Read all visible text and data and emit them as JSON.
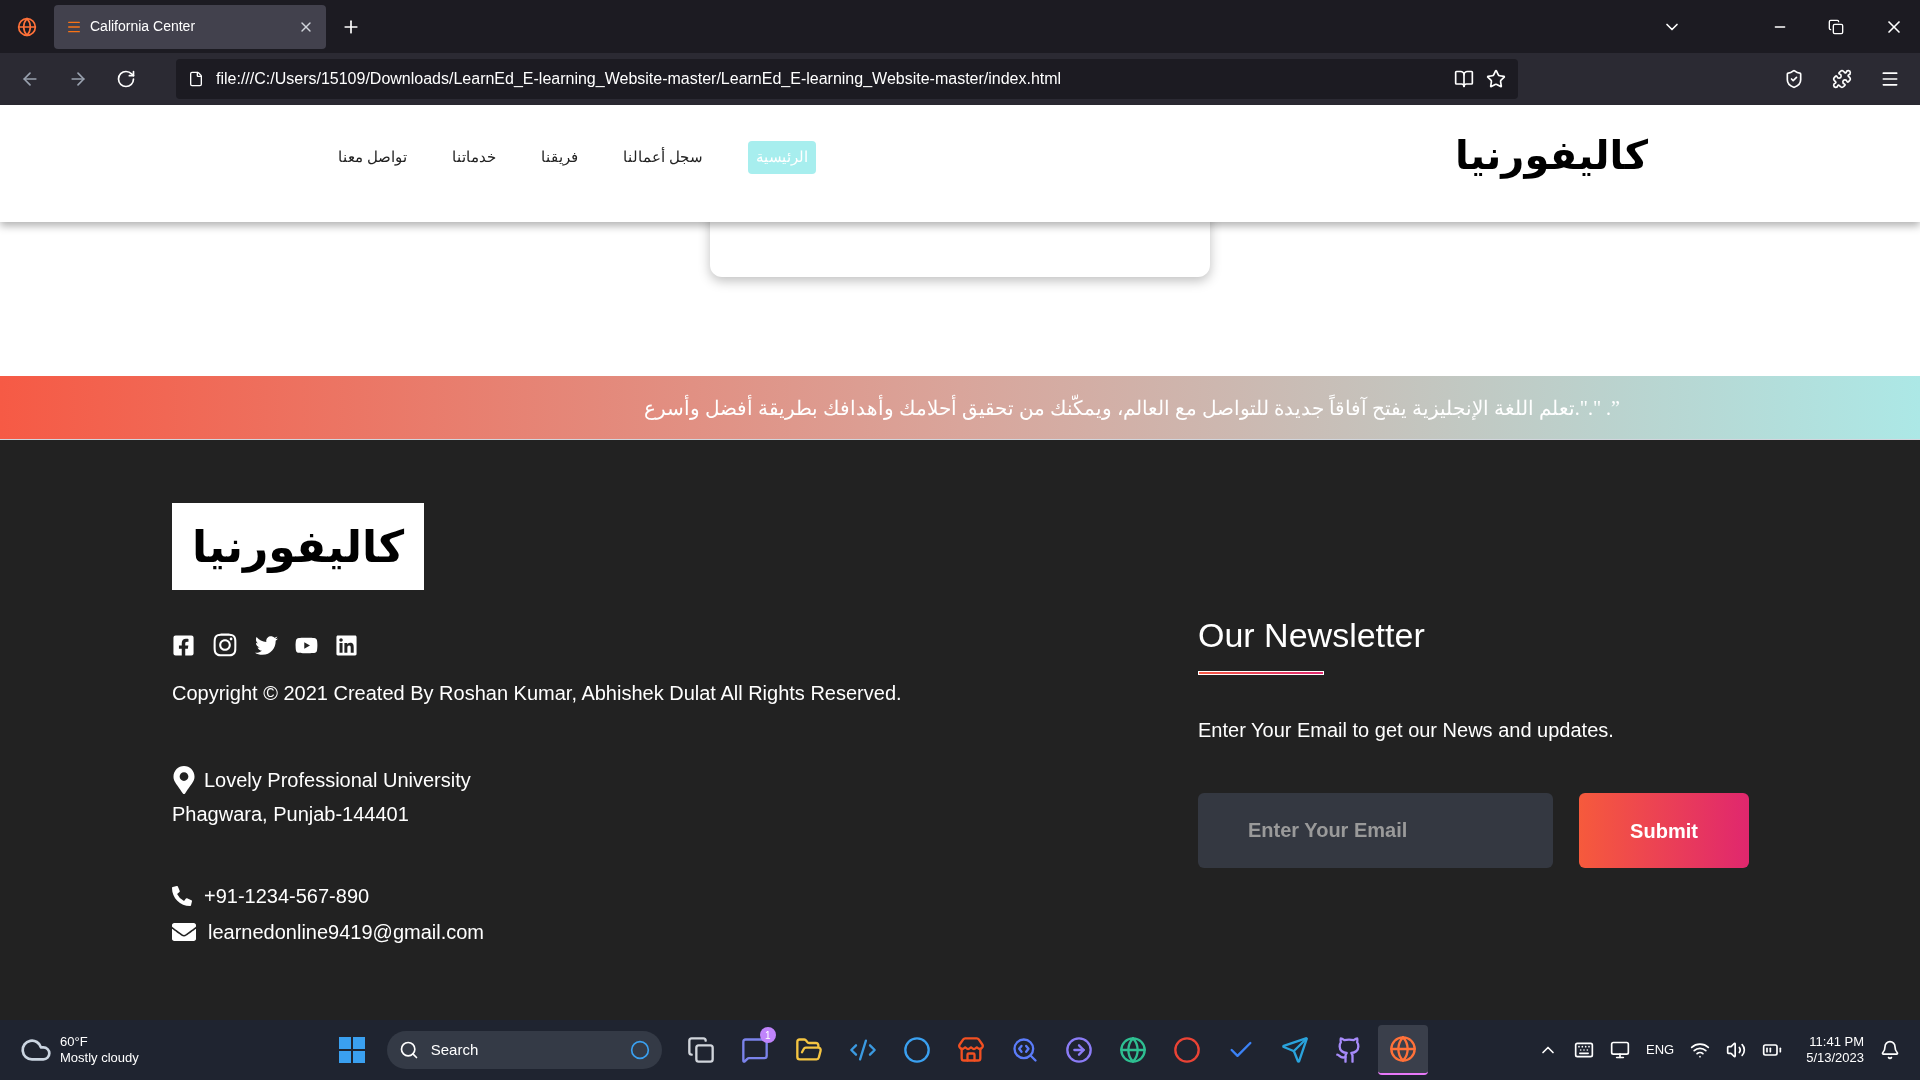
{
  "browser": {
    "tab_title": "California Center",
    "url": "file:///C:/Users/15109/Downloads/LearnEd_E-learning_Website-master/LearnEd_E-learning_Website-master/index.html"
  },
  "header": {
    "logo": "كاليفورنيا",
    "nav": [
      {
        "label": "الرئيسية",
        "selected": true
      },
      {
        "label": "سجل أعمالنا",
        "selected": false
      },
      {
        "label": "فريقنا",
        "selected": false
      },
      {
        "label": "خدماتنا",
        "selected": false
      },
      {
        "label": "تواصل معنا",
        "selected": false
      }
    ]
  },
  "banner": {
    "text": "”. \".\".تعلم اللغة الإنجليزية يفتح آفاقاً جديدة للتواصل مع العالم، ويمكّنك من تحقيق أحلامك وأهدافك بطريقة أفضل وأسرع"
  },
  "footer": {
    "logo": "كاليفورنيا",
    "socials": [
      {
        "kind": "facebook"
      },
      {
        "kind": "instagram"
      },
      {
        "kind": "twitter"
      },
      {
        "kind": "youtube"
      },
      {
        "kind": "linkedin"
      }
    ],
    "copyright": "Copyright © 2021 Created By Roshan Kumar, Abhishek Dulat All Rights Reserved.",
    "address": [
      "Lovely Professional University",
      "Phagwara, Punjab-144401"
    ],
    "phone": "+91-1234-567-890",
    "email": "learnedonline9419@gmail.com"
  },
  "newsletter": {
    "title": "Our Newsletter",
    "text": "Enter Your Email to get our News and updates.",
    "email_placeholder": "Enter Your Email",
    "submit": "Submit"
  },
  "taskbar": {
    "temperature": "60°F",
    "condition": "Mostly cloudy",
    "search_placeholder": "Search",
    "apps": [
      {
        "kind": "files",
        "selected": false
      },
      {
        "kind": "chat",
        "selected": false,
        "badge": "1"
      },
      {
        "kind": "folder",
        "selected": false
      },
      {
        "kind": "code",
        "selected": false
      },
      {
        "kind": "ring",
        "selected": false
      },
      {
        "kind": "store",
        "selected": false
      },
      {
        "kind": "magnifier",
        "selected": false
      },
      {
        "kind": "arrow",
        "selected": false
      },
      {
        "kind": "edge",
        "selected": false
      },
      {
        "kind": "chrome",
        "selected": false
      },
      {
        "kind": "check",
        "selected": false
      },
      {
        "kind": "telegram",
        "selected": false
      },
      {
        "kind": "github",
        "selected": false
      },
      {
        "kind": "firefox",
        "selected": true
      }
    ],
    "language": "ENG",
    "time": "11:41 PM",
    "date": "5/13/2023"
  }
}
